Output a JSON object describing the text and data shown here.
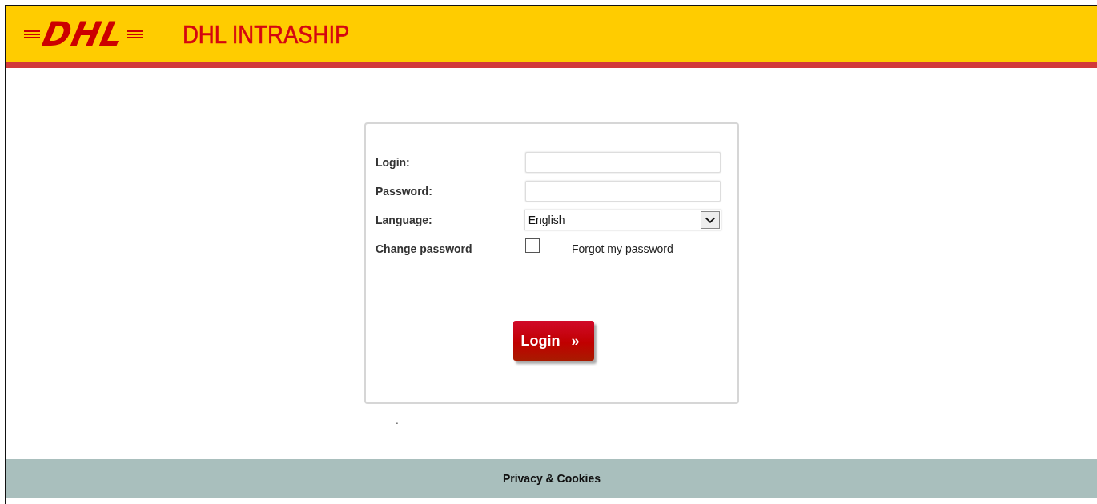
{
  "header": {
    "logo": "DHL",
    "title": "DHL INTRASHIP"
  },
  "form": {
    "fields": [
      {
        "kind": "text",
        "label": "Login:"
      },
      {
        "kind": "password",
        "label": "Password:"
      },
      {
        "kind": "select",
        "label": "Language:",
        "value": "English"
      }
    ],
    "change_password": {
      "label": "Change password",
      "checked": false
    },
    "forgot_link": "Forgot my password",
    "login_button": {
      "label": "Login",
      "icon": "»"
    }
  },
  "note": ".",
  "footer": {
    "link": "Privacy & Cookies"
  }
}
